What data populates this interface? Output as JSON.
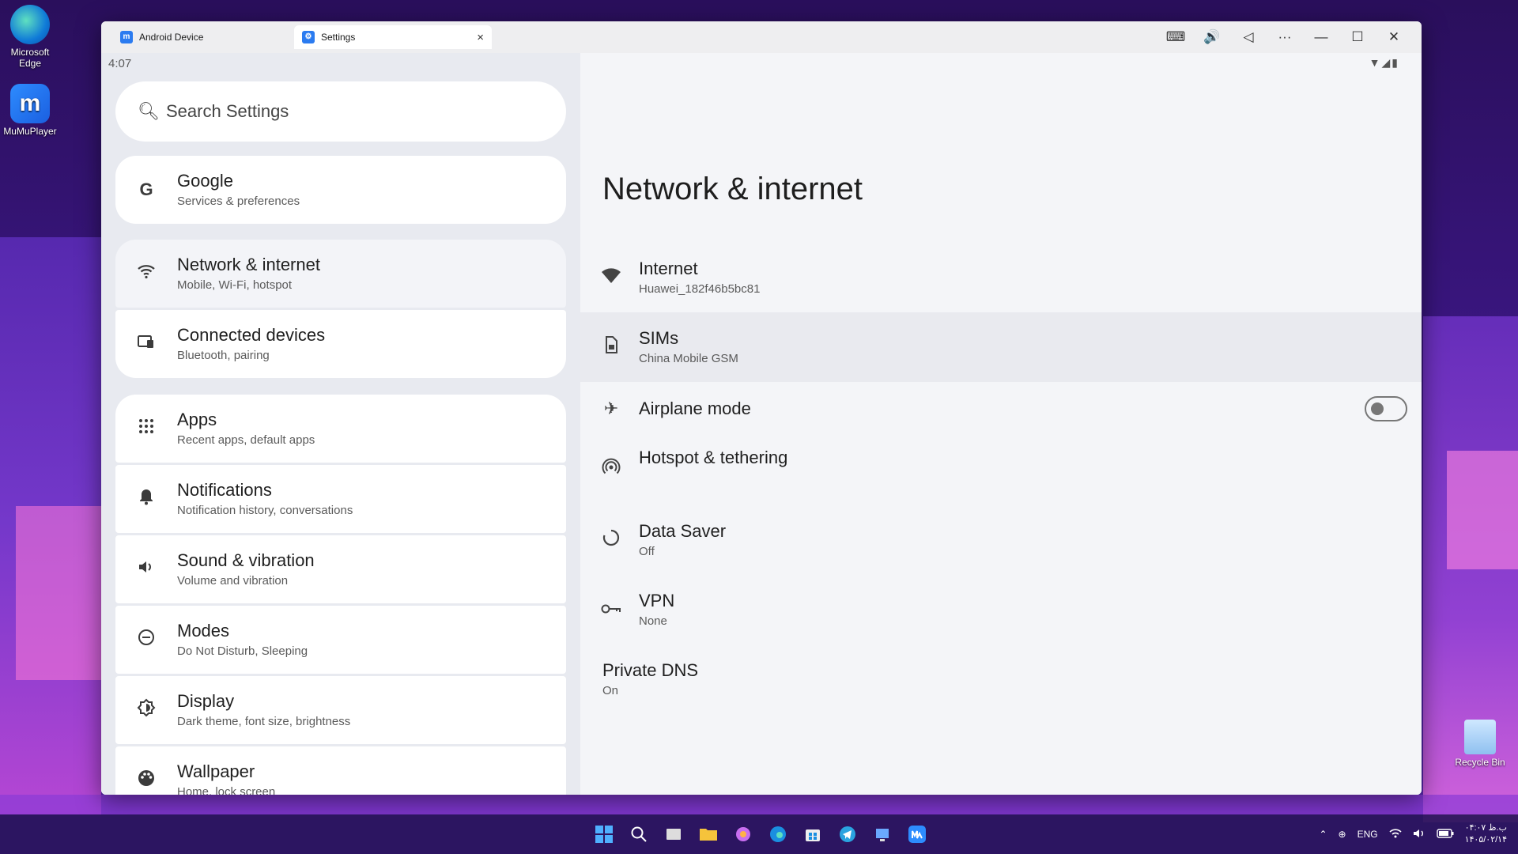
{
  "desktop": {
    "icons": [
      {
        "label": "Microsoft Edge",
        "icon": "edge-icon"
      },
      {
        "label": "MuMuPlayer",
        "icon": "mumu-icon"
      }
    ],
    "recycle_bin_label": "Recycle Bin"
  },
  "window": {
    "tabs": [
      {
        "label": "Android Device",
        "icon": "mumu-icon"
      },
      {
        "label": "Settings",
        "icon": "settings-gear-icon"
      }
    ],
    "close_tab_glyph": "×",
    "toolbar": {
      "keyboard": "⌨",
      "volume": "🔊",
      "back": "◁",
      "more": "···",
      "minimize": "—",
      "maximize": "☐",
      "close": "✕"
    }
  },
  "android": {
    "time": "4:07",
    "status_icons": "▼◢▮",
    "search_placeholder": "Search Settings",
    "settings_groups": [
      [
        {
          "title": "Google",
          "subtitle": "Services & preferences",
          "icon": "G"
        }
      ],
      [
        {
          "title": "Network & internet",
          "subtitle": "Mobile, Wi-Fi, hotspot",
          "icon": "wifi"
        },
        {
          "title": "Connected devices",
          "subtitle": "Bluetooth, pairing",
          "icon": "devices"
        }
      ],
      [
        {
          "title": "Apps",
          "subtitle": "Recent apps, default apps",
          "icon": "apps"
        },
        {
          "title": "Notifications",
          "subtitle": "Notification history, conversations",
          "icon": "bell"
        },
        {
          "title": "Sound & vibration",
          "subtitle": "Volume and vibration",
          "icon": "volume"
        },
        {
          "title": "Modes",
          "subtitle": "Do Not Disturb, Sleeping",
          "icon": "minus-circle"
        },
        {
          "title": "Display",
          "subtitle": "Dark theme, font size, brightness",
          "icon": "display"
        },
        {
          "title": "Wallpaper",
          "subtitle": "Home, lock screen",
          "icon": "palette"
        }
      ]
    ],
    "detail": {
      "title": "Network & internet",
      "items": [
        {
          "title": "Internet",
          "subtitle": "Huawei_182f46b5bc81",
          "icon": "wifi"
        },
        {
          "title": "SIMs",
          "subtitle": "China Mobile GSM",
          "icon": "sim"
        },
        {
          "title": "Airplane mode",
          "subtitle": "",
          "icon": "airplane",
          "toggle": false
        },
        {
          "title": "Hotspot & tethering",
          "subtitle": "",
          "icon": "hotspot"
        },
        {
          "title": "Data Saver",
          "subtitle": "Off",
          "icon": "data-saver"
        },
        {
          "title": "VPN",
          "subtitle": "None",
          "icon": "vpn-key"
        },
        {
          "title": "Private DNS",
          "subtitle": "On",
          "icon": ""
        }
      ]
    }
  },
  "taskbar": {
    "tray": {
      "lang": "ENG",
      "time_line1": "ب.ظ ۰۴:۰۷",
      "time_line2": "۱۴۰۵/۰۲/۱۴"
    }
  },
  "colors": {
    "accent_blue": "#2b7bf0",
    "selected_bg": "#e9eaef"
  }
}
